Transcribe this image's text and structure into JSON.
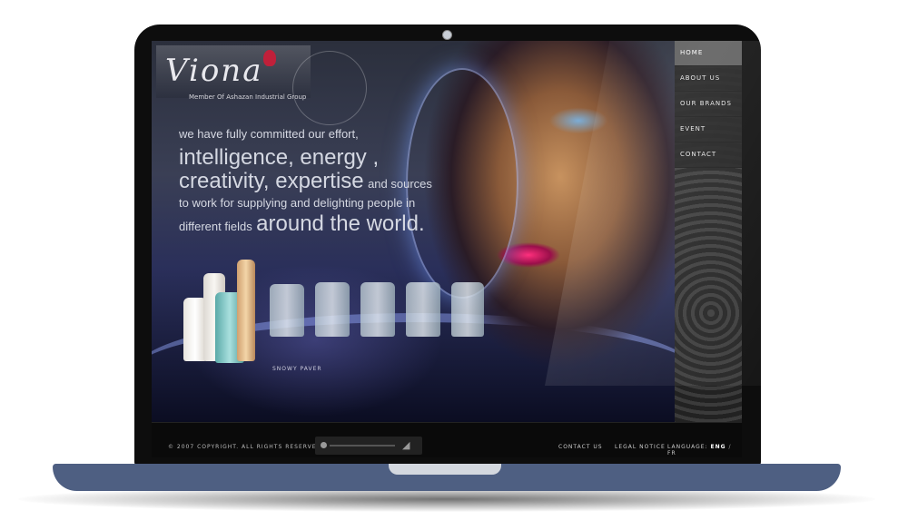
{
  "brand": {
    "logo_text": "Viona",
    "tagline": "Member Of Ashazan Industrial Group"
  },
  "hero": {
    "line1": "we have fully committed our effort,",
    "line2": "intelligence, energy ,",
    "line3a": "creativity, expertise",
    "line3b": "and sources",
    "line4": "to work for supplying and delighting people in",
    "line5a": "different fields",
    "line5b": "around the world.",
    "product_name": "SNOWY PAVER"
  },
  "nav": {
    "items": [
      {
        "label": "HOME"
      },
      {
        "label": "ABOUT US"
      },
      {
        "label": "OUR BRANDS"
      },
      {
        "label": "EVENT"
      },
      {
        "label": "CONTACT"
      }
    ]
  },
  "footer": {
    "copyright": "© 2007 COPYRIGHT. ALL RIGHTS RESERVED.",
    "contact_us": "CONTACT US",
    "legal_notice": "LEGAL NOTICE",
    "language_label": "LANGUAGE:",
    "lang_eng": "ENG",
    "lang_sep": "/",
    "lang_fr": "FR"
  },
  "colors": {
    "laptop_base": "#4e5f82",
    "nav_active": "#5d5d5d",
    "lip_accent": "#ff2f7c"
  }
}
